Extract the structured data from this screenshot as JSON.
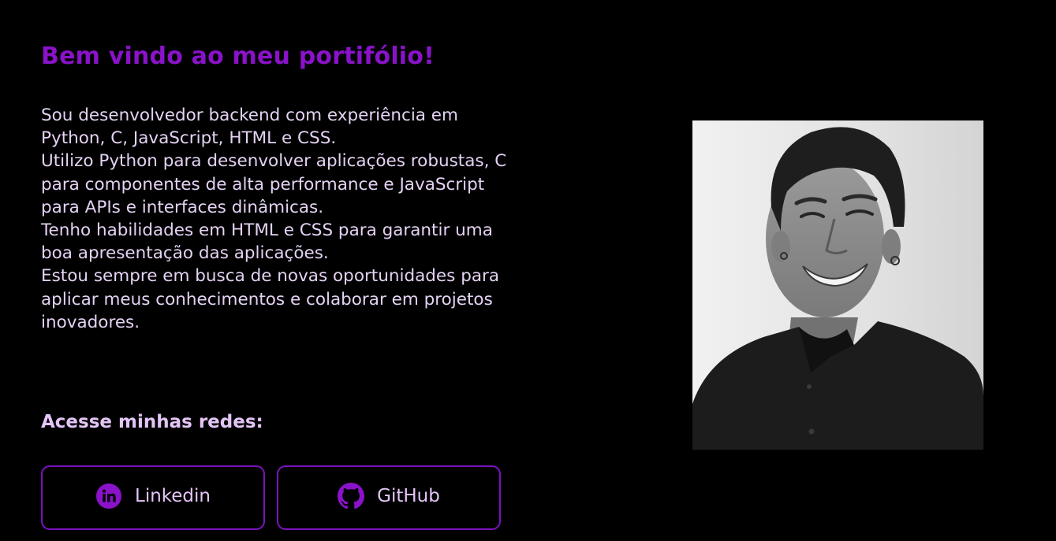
{
  "hero": {
    "title": "Bem vindo ao meu portifólio!",
    "bio": [
      "Sou desenvolvedor backend com experiência em Python, C, JavaScript, HTML e CSS.",
      "Utilizo Python para desenvolver aplicações robustas, C para componentes de alta performance e JavaScript para APIs e interfaces dinâmicas.",
      "Tenho habilidades em HTML e CSS para garantir uma boa apresentação das aplicações.",
      "Estou sempre em busca de novas oportunidades para aplicar meus conhecimentos e colaborar em projetos inovadores."
    ]
  },
  "networks": {
    "heading": "Acesse minhas redes:",
    "buttons": [
      {
        "label": "Linkedin",
        "icon": "linkedin-icon"
      },
      {
        "label": "GitHub",
        "icon": "github-icon"
      }
    ]
  },
  "photo": {
    "subject": "profile-photo"
  },
  "colors": {
    "background": "#000000",
    "accent": "#8a12c9",
    "button_border": "#7a12c0",
    "text": "#e4d2f3",
    "heading_light": "#e4c5f7"
  }
}
